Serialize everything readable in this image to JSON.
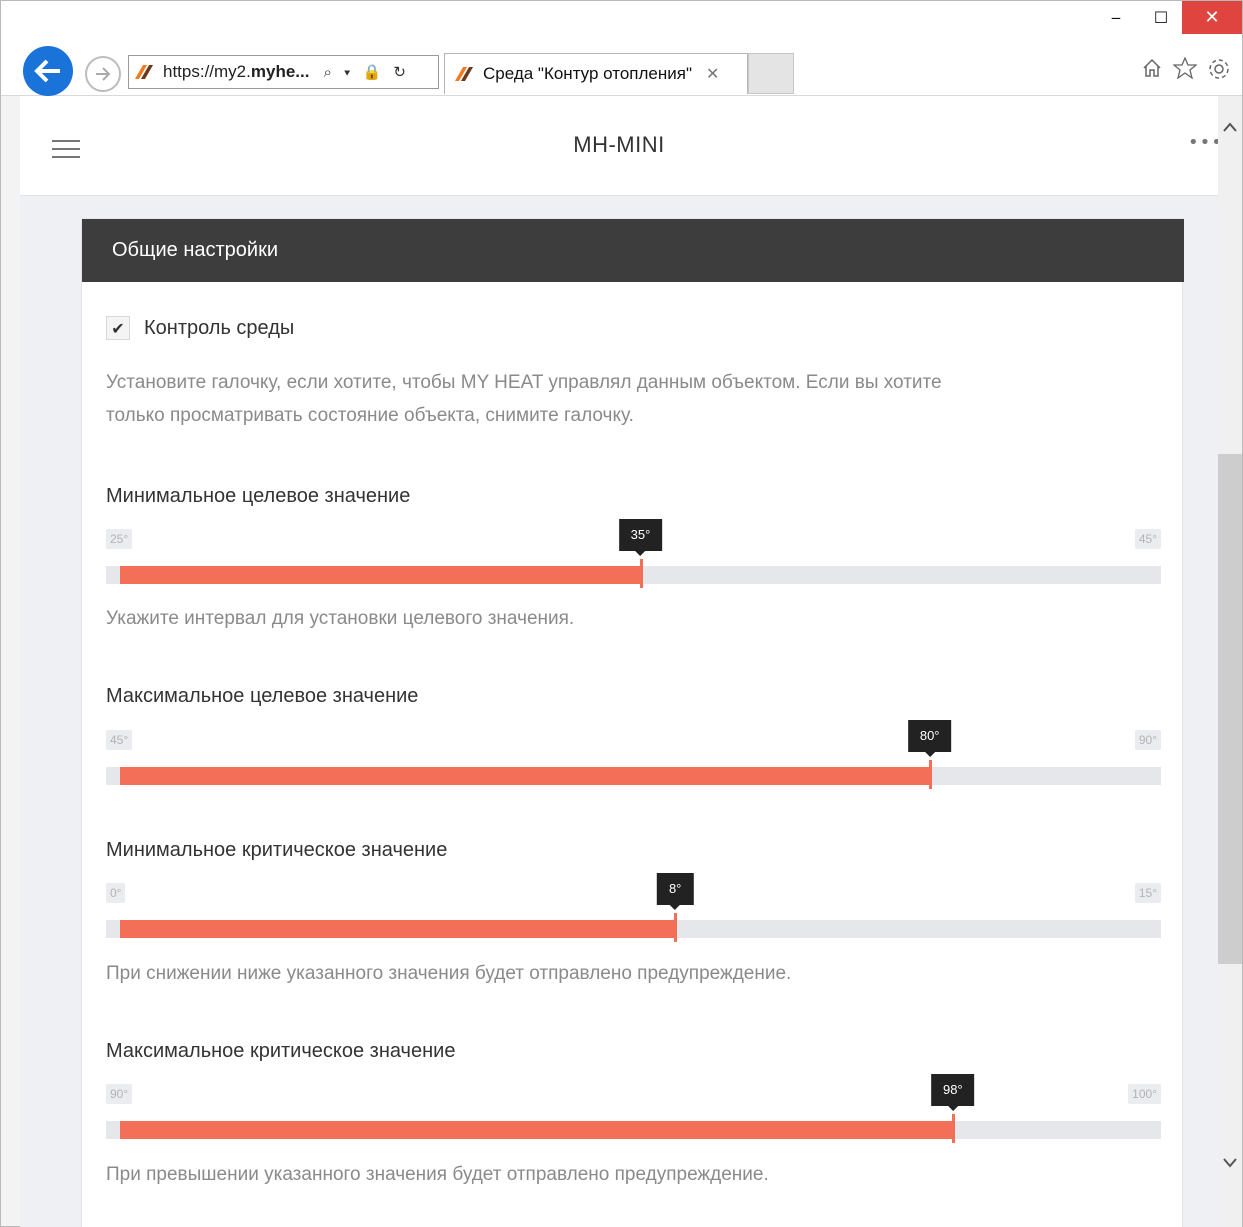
{
  "browser": {
    "url_prefix": "https://my2.",
    "url_host": "myhe...",
    "address_icons": "⌕ ▾ 🔒 ↻",
    "tab_title": "Среда \"Контур отопления\"",
    "tab_close": "✕",
    "window_min": "‒",
    "window_max": "☐",
    "window_close": "✕",
    "toolbar_icons": [
      "home-icon",
      "favorites-star-icon",
      "settings-gear-icon"
    ]
  },
  "app": {
    "title": "MH-MINI",
    "more": "•••"
  },
  "card": {
    "header": "Общие настройки",
    "control": {
      "checked": true,
      "label": "Контроль среды",
      "check_glyph": "✔"
    },
    "control_hint_line1": "Установите галочку, если хотите, чтобы MY HEAT управлял данным объектом. Если вы хотите",
    "control_hint_line2": "только просматривать состояние объекта, снимите галочку.",
    "sliders": [
      {
        "label": "Минимальное целевое значение",
        "min_label": "25°",
        "max_label": "45°",
        "value_label": "35°",
        "fraction": 0.5,
        "hint": "Укажите интервал для установки целевого значения."
      },
      {
        "label": "Максимальное целевое значение",
        "min_label": "45°",
        "max_label": "90°",
        "value_label": "80°",
        "fraction": 0.7778,
        "hint": ""
      },
      {
        "label": "Минимальное критическое значение",
        "min_label": "0°",
        "max_label": "15°",
        "value_label": "8°",
        "fraction": 0.5333,
        "hint": "При снижении ниже указанного значения будет отправлено предупреждение."
      },
      {
        "label": "Максимальное критическое значение",
        "min_label": "90°",
        "max_label": "100°",
        "value_label": "98°",
        "fraction": 0.8,
        "hint": "При превышении указанного значения будет отправлено предупреждение."
      }
    ]
  },
  "colors": {
    "accent": "#f36f58",
    "header_bg": "#3d3d3d",
    "back_button": "#1a73d9",
    "close_button": "#e0443e"
  }
}
